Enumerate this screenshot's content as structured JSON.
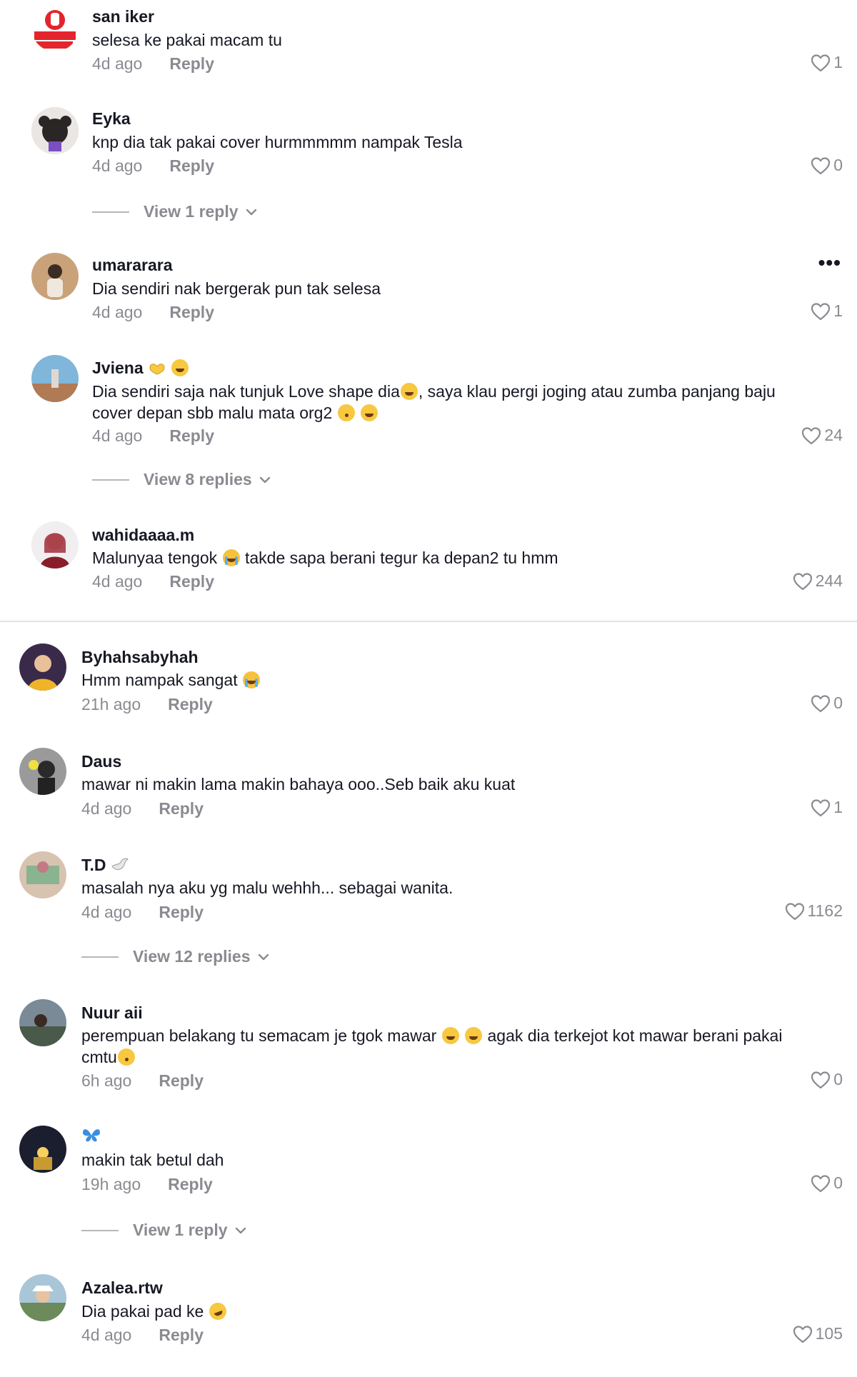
{
  "section1": {
    "comments": [
      {
        "username": "san iker",
        "text": "selesa ke pakai macam tu",
        "time": "4d ago",
        "reply_label": "Reply",
        "likes": "1"
      },
      {
        "username": "Eyka",
        "text": "knp dia tak pakai cover hurmmmmm nampak Tesla",
        "time": "4d ago",
        "reply_label": "Reply",
        "likes": "0",
        "view_replies": "View 1 reply"
      },
      {
        "username": "umararara",
        "text": "Dia sendiri nak bergerak pun tak selesa",
        "time": "4d ago",
        "reply_label": "Reply",
        "likes": "1",
        "more": "•••"
      },
      {
        "username": "Jviena",
        "text_line1": "Dia sendiri saja nak tunjuk Love shape dia",
        "text_line1b": ", saya klau pergi joging atau zumba panjang baju",
        "text_line2": "cover depan sbb malu mata org2",
        "time": "4d ago",
        "reply_label": "Reply",
        "likes": "24",
        "view_replies": "View 8 replies"
      },
      {
        "username": "wahidaaaa.m",
        "text_a": "Malunyaa tengok",
        "text_b": "takde sapa berani tegur ka depan2 tu hmm",
        "time": "4d ago",
        "reply_label": "Reply",
        "likes": "244"
      }
    ]
  },
  "section2": {
    "comments": [
      {
        "username": "Byhahsabyhah",
        "text": "Hmm nampak sangat",
        "time": "21h ago",
        "reply_label": "Reply",
        "likes": "0"
      },
      {
        "username": "Daus",
        "text": "mawar ni makin lama makin bahaya ooo..Seb baik aku kuat",
        "time": "4d ago",
        "reply_label": "Reply",
        "likes": "1"
      },
      {
        "username": "T.D",
        "text": "masalah nya aku yg malu wehhh... sebagai wanita.",
        "time": "4d ago",
        "reply_label": "Reply",
        "likes": "1162",
        "view_replies": "View 12 replies"
      },
      {
        "username": "Nuur aii",
        "text_a": "perempuan belakang tu semacam je tgok mawar",
        "text_b": "agak dia terkejot kot mawar berani pakai",
        "text_line2": "cmtu",
        "time": "6h ago",
        "reply_label": "Reply",
        "likes": "0"
      },
      {
        "username": "",
        "text": "makin tak betul dah",
        "time": "19h ago",
        "reply_label": "Reply",
        "likes": "0",
        "view_replies": "View 1 reply"
      },
      {
        "username": "Azalea.rtw",
        "text": "Dia pakai pad ke",
        "time": "4d ago",
        "reply_label": "Reply",
        "likes": "105"
      }
    ]
  },
  "icons": {
    "like": "heart-outline-icon",
    "chevron": "chevron-down-icon",
    "more": "more-options-icon"
  },
  "colors": {
    "text": "#161823",
    "secondary": "#8a8b91",
    "divider": "#e3e3e6"
  }
}
